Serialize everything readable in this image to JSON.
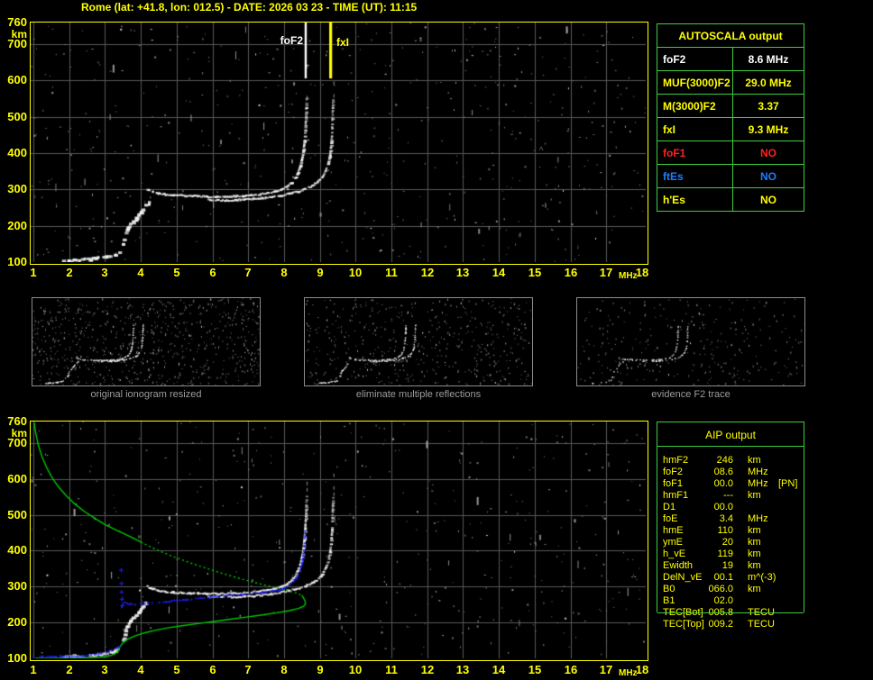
{
  "title_text": "Rome (lat: +41.8, lon: 012.5) - DATE: 2026 03 23 - TIME (UT): 11:15",
  "colors": {
    "accent_yellow": "#ffff00",
    "table_border_green": "#3ecf3e",
    "profile_green": "#00c800",
    "restored_trace_blue": "#2020ff",
    "ftes_blue": "#1f7cff",
    "alert_red": "#ff2020",
    "trace_white": "#ffffff",
    "grid_gray": "#585858",
    "caption_gray": "#9c9c9c"
  },
  "autoscala": {
    "header": "AUTOSCALA output",
    "rows": [
      {
        "label": "foF2",
        "value": "8.6 MHz",
        "color": "#ffffff"
      },
      {
        "label": "MUF(3000)F2",
        "value": "29.0 MHz",
        "color": "#ffff00"
      },
      {
        "label": "M(3000)F2",
        "value": "3.37",
        "color": "#ffff00"
      },
      {
        "label": "fxI",
        "value": "9.3 MHz",
        "color": "#ffff00"
      },
      {
        "label": "foF1",
        "value": "NO",
        "color": "#ff2020"
      },
      {
        "label": "ftEs",
        "value": "NO",
        "color": "#1f7cff"
      },
      {
        "label": "h'Es",
        "value": "NO",
        "color": "#ffff00"
      }
    ]
  },
  "aip": {
    "header": "AIP output",
    "rows": [
      {
        "label": "hmF2",
        "value": "246",
        "unit": "km",
        "extra": ""
      },
      {
        "label": "foF2",
        "value": "08.6",
        "unit": "MHz",
        "extra": ""
      },
      {
        "label": "foF1",
        "value": "00.0",
        "unit": "MHz",
        "extra": "[PN]"
      },
      {
        "label": "hmF1",
        "value": "---",
        "unit": "km",
        "extra": ""
      },
      {
        "label": "D1",
        "value": "00.0",
        "unit": "",
        "extra": ""
      },
      {
        "label": "foE",
        "value": "3.4",
        "unit": "MHz",
        "extra": ""
      },
      {
        "label": "hmE",
        "value": "110",
        "unit": "km",
        "extra": ""
      },
      {
        "label": "ymE",
        "value": "20",
        "unit": "km",
        "extra": ""
      },
      {
        "label": "h_vE",
        "value": "119",
        "unit": "km",
        "extra": ""
      },
      {
        "label": "Ewidth",
        "value": "19",
        "unit": "km",
        "extra": ""
      },
      {
        "label": "DelN_vE",
        "value": "00.1",
        "unit": "m^(-3)",
        "extra": ""
      },
      {
        "label": "B0",
        "value": "066.0",
        "unit": "km",
        "extra": ""
      },
      {
        "label": "B1",
        "value": "02.0",
        "unit": "",
        "extra": ""
      },
      {
        "label": "TEC[Bot]",
        "value": "005.8",
        "unit": "TECU",
        "extra": ""
      },
      {
        "label": "TEC[Top]",
        "value": "009.2",
        "unit": "TECU",
        "extra": ""
      }
    ]
  },
  "thumbnails": [
    {
      "caption": "original ionogram resized"
    },
    {
      "caption": "eliminate multiple reflections"
    },
    {
      "caption": "evidence F2 trace"
    }
  ],
  "chart_data": {
    "type": "scatter",
    "x_unit": "MHz",
    "y_unit": "km",
    "xlim": [
      1,
      18
    ],
    "ylim": [
      100,
      760
    ],
    "grid": true,
    "x_ticks": [
      1,
      2,
      3,
      4,
      5,
      6,
      7,
      8,
      9,
      10,
      11,
      12,
      13,
      14,
      15,
      16,
      17,
      18
    ],
    "y_ticks": [
      760,
      700,
      600,
      500,
      400,
      300,
      200,
      100
    ],
    "echo_trace_series": [
      {
        "name": "F2 ordinary trace",
        "color": "#ffffff",
        "points": [
          [
            4.2,
            300
          ],
          [
            4.35,
            293
          ],
          [
            4.5,
            289
          ],
          [
            4.7,
            286
          ],
          [
            4.9,
            284
          ],
          [
            5.1,
            283
          ],
          [
            5.35,
            282
          ],
          [
            5.6,
            281
          ],
          [
            5.85,
            280
          ],
          [
            6.1,
            280
          ],
          [
            6.35,
            280
          ],
          [
            6.6,
            281
          ],
          [
            6.85,
            282
          ],
          [
            7.1,
            284
          ],
          [
            7.35,
            287
          ],
          [
            7.55,
            290
          ],
          [
            7.75,
            294
          ],
          [
            7.95,
            300
          ],
          [
            8.1,
            308
          ],
          [
            8.22,
            318
          ],
          [
            8.32,
            330
          ],
          [
            8.4,
            345
          ],
          [
            8.46,
            362
          ],
          [
            8.51,
            382
          ],
          [
            8.55,
            405
          ],
          [
            8.58,
            432
          ],
          [
            8.6,
            462
          ],
          [
            8.62,
            495
          ],
          [
            8.63,
            525
          ],
          [
            8.64,
            552
          ]
        ]
      },
      {
        "name": "F2 extraordinary trace",
        "color": "#ffffff",
        "points": [
          [
            5.9,
            272
          ],
          [
            6.15,
            271
          ],
          [
            6.4,
            270
          ],
          [
            6.65,
            271
          ],
          [
            6.9,
            272
          ],
          [
            7.15,
            274
          ],
          [
            7.4,
            276
          ],
          [
            7.65,
            279
          ],
          [
            7.9,
            283
          ],
          [
            8.15,
            288
          ],
          [
            8.4,
            294
          ],
          [
            8.6,
            301
          ],
          [
            8.8,
            310
          ],
          [
            8.95,
            321
          ],
          [
            9.08,
            335
          ],
          [
            9.18,
            352
          ],
          [
            9.25,
            373
          ],
          [
            9.3,
            398
          ],
          [
            9.33,
            427
          ],
          [
            9.35,
            458
          ],
          [
            9.36,
            492
          ],
          [
            9.37,
            525
          ],
          [
            9.38,
            548
          ]
        ]
      },
      {
        "name": "E-F1 rising echoes",
        "color": "#ffffff",
        "points": [
          [
            3.52,
            152
          ],
          [
            3.57,
            166
          ],
          [
            3.6,
            180
          ],
          [
            3.65,
            192
          ],
          [
            3.72,
            202
          ],
          [
            3.8,
            210
          ],
          [
            3.88,
            218
          ],
          [
            3.95,
            227
          ],
          [
            4.02,
            237
          ],
          [
            4.08,
            247
          ],
          [
            4.15,
            255
          ],
          [
            4.25,
            261
          ],
          [
            4.35,
            265
          ]
        ]
      },
      {
        "name": "E region echoes",
        "color": "#ffffff",
        "points": [
          [
            1.85,
            104
          ],
          [
            2.0,
            103
          ],
          [
            2.15,
            106
          ],
          [
            2.3,
            105
          ],
          [
            2.45,
            107
          ],
          [
            2.6,
            107
          ],
          [
            2.75,
            110
          ],
          [
            2.9,
            112
          ],
          [
            3.05,
            114
          ],
          [
            3.18,
            117
          ],
          [
            3.3,
            121
          ],
          [
            3.42,
            127
          ]
        ]
      }
    ],
    "main_ionogram": {
      "markers": [
        {
          "label": "foF2",
          "f_mhz": 8.6,
          "color": "#ffffff"
        },
        {
          "label": "fxI",
          "f_mhz": 9.3,
          "color": "#ffff00"
        }
      ]
    },
    "profile_ionogram": {
      "restored_trace_color": "#2020ff",
      "restored_trace_segments": [
        [
          [
            1.0,
            105
          ],
          [
            1.25,
            105
          ],
          [
            1.5,
            105
          ],
          [
            1.75,
            105
          ],
          [
            2.0,
            105
          ],
          [
            2.2,
            105
          ],
          [
            2.38,
            106
          ],
          [
            2.55,
            108
          ],
          [
            2.72,
            111
          ],
          [
            2.9,
            114
          ],
          [
            3.05,
            117
          ],
          [
            3.18,
            121
          ],
          [
            3.3,
            127
          ],
          [
            3.4,
            133
          ]
        ],
        [
          [
            3.47,
            242
          ],
          [
            3.5,
            250
          ],
          [
            3.55,
            255
          ],
          [
            3.62,
            253
          ],
          [
            3.72,
            251
          ],
          [
            3.85,
            250
          ],
          [
            4.0,
            251
          ],
          [
            4.2,
            253
          ],
          [
            4.45,
            255
          ],
          [
            4.7,
            258
          ],
          [
            5.0,
            261
          ],
          [
            5.3,
            264
          ],
          [
            5.6,
            267
          ],
          [
            5.9,
            270
          ],
          [
            6.2,
            273
          ],
          [
            6.5,
            276
          ],
          [
            6.8,
            278
          ],
          [
            7.1,
            281
          ],
          [
            7.4,
            284
          ],
          [
            7.65,
            287
          ],
          [
            7.85,
            291
          ],
          [
            8.0,
            296
          ],
          [
            8.15,
            304
          ],
          [
            8.27,
            314
          ],
          [
            8.37,
            327
          ],
          [
            8.45,
            343
          ],
          [
            8.5,
            362
          ],
          [
            8.54,
            385
          ],
          [
            8.57,
            412
          ],
          [
            8.59,
            440
          ],
          [
            8.6,
            455
          ]
        ]
      ],
      "restored_trace_marks": [
        [
          3.44,
          347
        ],
        [
          3.45,
          310
        ],
        [
          3.45,
          286
        ],
        [
          3.46,
          266
        ],
        [
          3.47,
          248
        ]
      ],
      "profile_curve_color": "#00c800",
      "profile_curve": {
        "solid_topside": [
          [
            1.02,
            758
          ],
          [
            1.07,
            726
          ],
          [
            1.14,
            694
          ],
          [
            1.24,
            662
          ],
          [
            1.37,
            632
          ],
          [
            1.52,
            604
          ],
          [
            1.7,
            578
          ],
          [
            1.92,
            553
          ],
          [
            2.16,
            530
          ],
          [
            2.43,
            509
          ],
          [
            2.72,
            490
          ],
          [
            3.02,
            472
          ],
          [
            3.32,
            457
          ],
          [
            3.6,
            444
          ],
          [
            3.85,
            432
          ],
          [
            4.0,
            424
          ]
        ],
        "dotted_middle": [
          [
            4.0,
            424
          ],
          [
            4.45,
            402
          ],
          [
            4.95,
            382
          ],
          [
            5.5,
            362
          ],
          [
            6.05,
            344
          ],
          [
            6.6,
            327
          ],
          [
            7.15,
            312
          ],
          [
            7.65,
            300
          ],
          [
            8.05,
            290
          ],
          [
            8.35,
            282
          ],
          [
            8.5,
            276
          ]
        ],
        "solid_bottomside": [
          [
            8.5,
            276
          ],
          [
            8.58,
            262
          ],
          [
            8.6,
            252
          ],
          [
            8.55,
            245
          ],
          [
            8.4,
            239
          ],
          [
            8.15,
            233
          ],
          [
            7.8,
            227
          ],
          [
            7.4,
            221
          ],
          [
            6.95,
            215
          ],
          [
            6.5,
            209
          ],
          [
            6.05,
            203
          ],
          [
            5.6,
            197
          ],
          [
            5.15,
            191
          ],
          [
            4.75,
            185
          ],
          [
            4.4,
            178
          ],
          [
            4.1,
            171
          ],
          [
            3.85,
            163
          ],
          [
            3.65,
            154
          ],
          [
            3.52,
            145
          ],
          [
            3.44,
            136
          ],
          [
            3.39,
            128
          ],
          [
            3.36,
            121
          ],
          [
            3.3,
            114
          ],
          [
            3.2,
            109
          ],
          [
            3.05,
            105
          ],
          [
            2.8,
            103
          ],
          [
            2.5,
            102
          ],
          [
            2.1,
            101
          ],
          [
            1.6,
            100
          ],
          [
            1.05,
            100
          ]
        ]
      }
    }
  }
}
